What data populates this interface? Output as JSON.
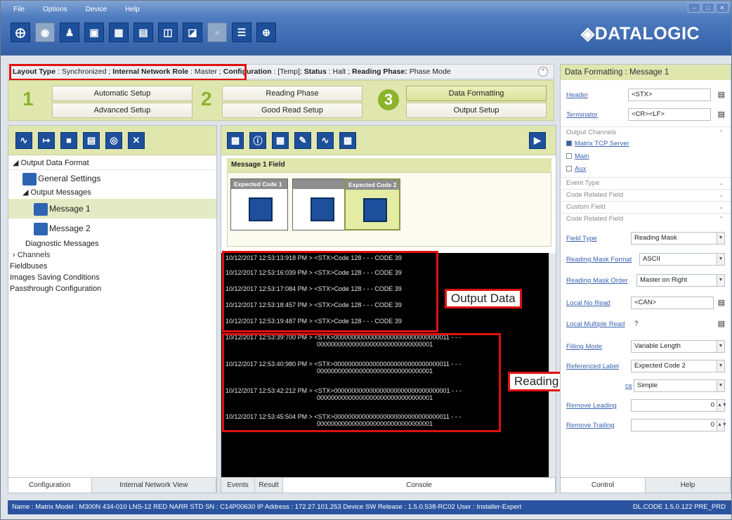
{
  "menu": [
    "File",
    "Options",
    "Device",
    "Help"
  ],
  "logo": "◈DATALOGIC",
  "window_controls": [
    "–",
    "□",
    "✕"
  ],
  "status": {
    "k1": "Layout Type",
    "v1": ": Synchronized ;",
    "k2": "Internal Network Role",
    "v2": ": Master ;",
    "k3": "Configuration",
    "v3": ": [Temp];",
    "k4": "Status",
    "v4": ": Halt ;",
    "k5": "Reading Phase:",
    "v5": "Phase Mode"
  },
  "steps": {
    "n1": "1",
    "n2": "2",
    "n3": "3",
    "automatic": "Automatic Setup",
    "advanced": "Advanced Setup",
    "reading": "Reading Phase",
    "goodread": "Good Read Setup",
    "dataformat": "Data Formatting",
    "output": "Output Setup"
  },
  "tree": [
    "Output Data Format",
    "General Settings",
    "Output Messages",
    "Message 1",
    "Message 2",
    "Diagnostic Messages",
    "Channels",
    "Fieldbuses",
    "Images Saving Conditions",
    "Passthrough Configuration"
  ],
  "left_tabs": [
    "Configuration",
    "Internal Network View"
  ],
  "mid": {
    "field_title": "Message 1 Field",
    "box1": "Expected Code 1",
    "box2": "Expected Code 2",
    "tabs": [
      "Events",
      "Result"
    ],
    "console_label": "Console"
  },
  "console_lines": [
    "10/12/2017 12:53:13:918 PM > <STX>Code 128 - - - CODE 39",
    "10/12/2017 12:53:16:039 PM > <STX>Code 128 - - - CODE 39",
    "10/12/2017 12:53:17:084 PM > <STX>Code 128 - - - CODE 39",
    "10/12/2017 12:53:18:457 PM > <STX>Code 128 - - - CODE 39",
    "10/12/2017 12:53:19:487 PM > <STX>Code 128 - - - CODE 39",
    "10/12/2017 12:53:39:700 PM > <STX>000000000000000000000000000000011 - - -",
    "000000000000000000000000000000001",
    "10/12/2017 12:53:40:980 PM > <STX>000000000000000000000000000000011 - - -",
    "000000000000000000000000000000001",
    "10/12/2017 12:53:42:212 PM > <STX>000000000000000000000000000000001 - - -",
    "000000000000000000000000000000001",
    "10/12/2017 12:53:45:504 PM > <STX>000000000000000000000000000000011 - - -",
    "000000000000000000000000000000001"
  ],
  "callouts": {
    "output": "Output Data",
    "mask": "Reading Mask"
  },
  "right": {
    "title": "Data Formatting : Message 1",
    "header_label": "Header",
    "header_value": "<STX>",
    "terminator_label": "Terminator",
    "terminator_value": "<CR><LF>",
    "out_channels": "Output Channels",
    "ch1": "Matrix TCP Server",
    "ch2": "Main",
    "ch3": "Aux",
    "sec1": "Event Type",
    "sec2": "Code Related Field",
    "sec3": "Custom Field",
    "sec4": "Code Related Field",
    "field_type_label": "Field Type",
    "field_type": "Reading Mask",
    "rm_format_label": "Reading Mask Format",
    "rm_format": "ASCII",
    "rm_order_label": "Reading Mask Order",
    "rm_order": "Master on Right",
    "noread_label": "Local No Read",
    "noread": "<CAN>",
    "multread_label": "Local Multiple Read",
    "multread": "?",
    "filling_label": "Filling Mode",
    "filling": "Variable Length",
    "ref_label": "Referenced Label",
    "ref": "Expected Code  2",
    "partial_label": "ce",
    "partial": "Simple",
    "rem_lead_label": "Remove Leading",
    "rem_lead": "0",
    "rem_trail_label": "Remove Trailing",
    "rem_trail": "0",
    "tabs": [
      "Control",
      "Help"
    ]
  },
  "bottom": {
    "left": "Name : Matrix   Model : M300N 434-010 LNS-12 RED NARR STD   SN : C14P00630   IP Address : 172.27.101.253   Device SW Release : 1.5.0.538-RC02   User : Installer-Expert",
    "right": "DL.CODE 1.5.0.122 PRE_PRD"
  }
}
